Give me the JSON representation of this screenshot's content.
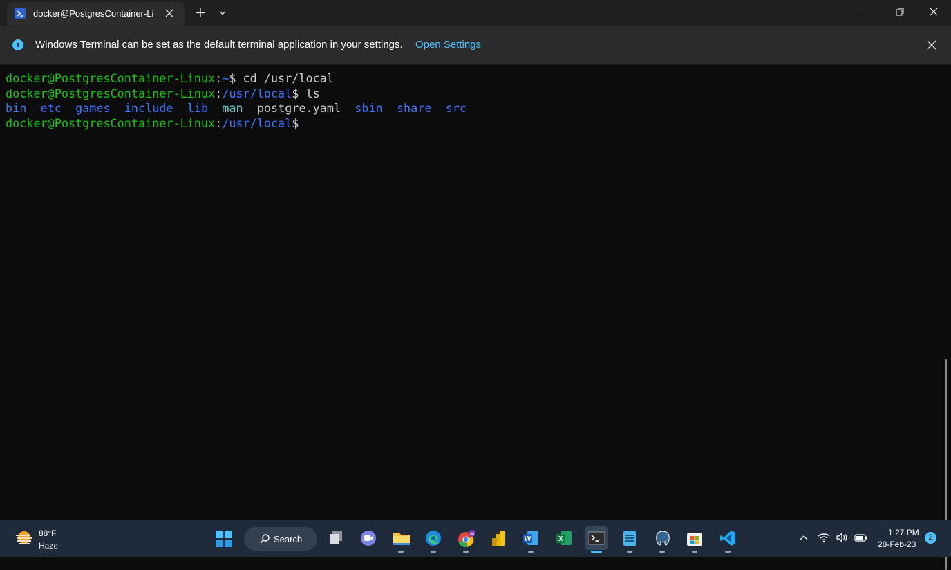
{
  "window": {
    "tab_title": "docker@PostgresContainer-Li"
  },
  "infobar": {
    "message": "Windows Terminal can be set as the default terminal application in your settings.",
    "link": "Open Settings"
  },
  "terminal": {
    "lines": [
      [
        {
          "t": "docker@PostgresContainer-Linux",
          "c": "green"
        },
        {
          "t": ":",
          "c": "white"
        },
        {
          "t": "~",
          "c": "blue"
        },
        {
          "t": "$ cd /usr/local",
          "c": "white"
        }
      ],
      [
        {
          "t": "docker@PostgresContainer-Linux",
          "c": "green"
        },
        {
          "t": ":",
          "c": "white"
        },
        {
          "t": "/usr/local",
          "c": "blue"
        },
        {
          "t": "$ ls",
          "c": "white"
        }
      ],
      [
        {
          "t": "bin",
          "c": "dblue"
        },
        {
          "t": "  ",
          "c": "white"
        },
        {
          "t": "etc",
          "c": "dblue"
        },
        {
          "t": "  ",
          "c": "white"
        },
        {
          "t": "games",
          "c": "dblue"
        },
        {
          "t": "  ",
          "c": "white"
        },
        {
          "t": "include",
          "c": "dblue"
        },
        {
          "t": "  ",
          "c": "white"
        },
        {
          "t": "lib",
          "c": "dblue"
        },
        {
          "t": "  ",
          "c": "white"
        },
        {
          "t": "man",
          "c": "cyan"
        },
        {
          "t": "  ",
          "c": "white"
        },
        {
          "t": "postgre.yaml",
          "c": "white"
        },
        {
          "t": "  ",
          "c": "white"
        },
        {
          "t": "sbin",
          "c": "dblue"
        },
        {
          "t": "  ",
          "c": "white"
        },
        {
          "t": "share",
          "c": "dblue"
        },
        {
          "t": "  ",
          "c": "white"
        },
        {
          "t": "src",
          "c": "dblue"
        }
      ],
      [
        {
          "t": "docker@PostgresContainer-Linux",
          "c": "green"
        },
        {
          "t": ":",
          "c": "white"
        },
        {
          "t": "/usr/local",
          "c": "blue"
        },
        {
          "t": "$",
          "c": "white"
        }
      ]
    ]
  },
  "taskbar": {
    "weather": {
      "temp": "88°F",
      "condition": "Haze"
    },
    "search_label": "Search",
    "apps": [
      {
        "name": "task-view-icon"
      },
      {
        "name": "teams-chat-icon"
      },
      {
        "name": "file-explorer-icon"
      },
      {
        "name": "edge-icon"
      },
      {
        "name": "chrome-icon"
      },
      {
        "name": "power-bi-icon"
      },
      {
        "name": "word-icon"
      },
      {
        "name": "excel-icon"
      },
      {
        "name": "terminal-icon"
      },
      {
        "name": "notepad-icon"
      },
      {
        "name": "pgadmin-icon"
      },
      {
        "name": "microsoft-store-icon"
      },
      {
        "name": "vscode-icon"
      }
    ],
    "clock": {
      "time": "1:27 PM",
      "date": "28-Feb-23"
    },
    "notification_count": "2"
  }
}
